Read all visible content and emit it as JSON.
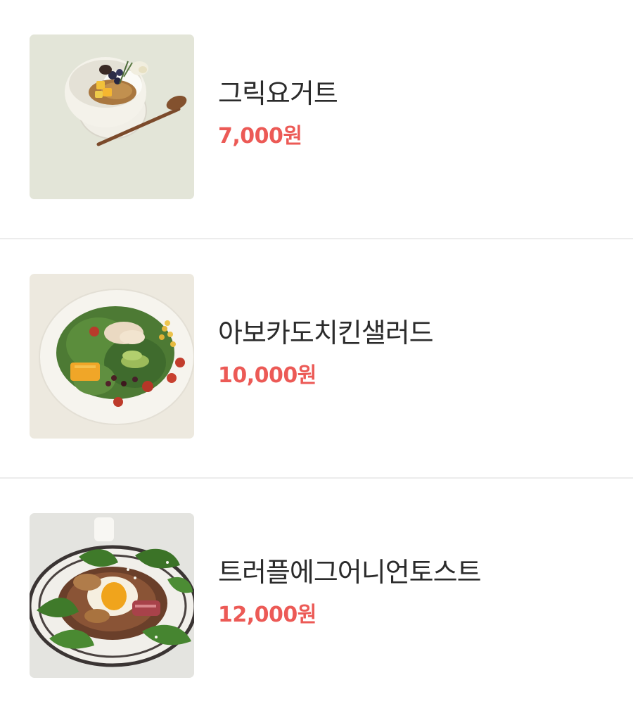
{
  "menu": {
    "items": [
      {
        "name": "그릭요거트",
        "price": "7,000원",
        "image": "greek-yogurt-bowl-photo"
      },
      {
        "name": "아보카도치킨샐러드",
        "price": "10,000원",
        "image": "avocado-chicken-salad-photo"
      },
      {
        "name": "트러플에그어니언토스트",
        "price": "12,000원",
        "image": "truffle-egg-onion-toast-photo"
      }
    ]
  },
  "colors": {
    "price": "#ec5a56",
    "name": "#2b2b2b",
    "divider": "#ececec",
    "background": "#ffffff"
  }
}
